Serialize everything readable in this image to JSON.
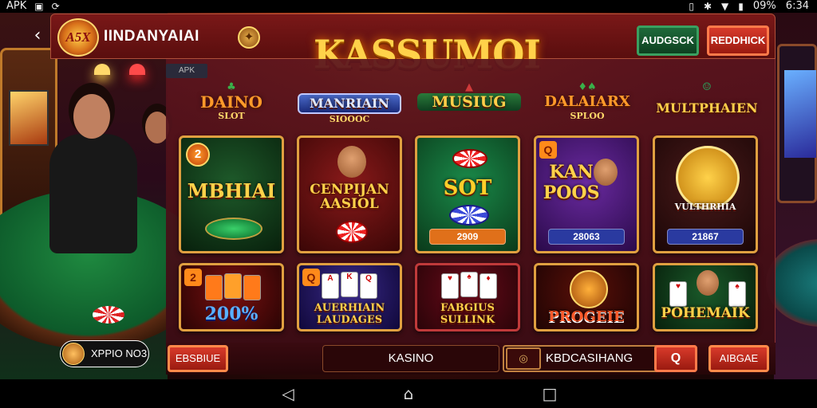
{
  "statusbar": {
    "left_label": "APK",
    "right_battery": "09%",
    "time": "6:34"
  },
  "header": {
    "app_title": "IINDANYAIAI",
    "logo_text": "A5X",
    "hero_title": "KASSUMOI",
    "btn_green": "AUDGSCK",
    "btn_red": "REDDHICK"
  },
  "categories": [
    {
      "main": "DAINO",
      "sub": "SLOT",
      "color": "#ff9a2a"
    },
    {
      "main": "MANRIAIN",
      "sub": "SIOOOC",
      "color": "#4a8ad8"
    },
    {
      "main": "MUSIUG",
      "sub": "",
      "color": "#ffcf4a"
    },
    {
      "main": "DALAIARX",
      "sub": "SPLOO",
      "color": "#ff9a2a"
    },
    {
      "main": "MULTPHAIEN",
      "sub": "",
      "color": "#ffcf4a"
    }
  ],
  "tiles_row1": [
    {
      "label": "MBHIAI",
      "badge": "2",
      "price": ""
    },
    {
      "label": "CENPIJAN AASIOL",
      "badge": "",
      "price": ""
    },
    {
      "label": "SOT",
      "badge": "",
      "price": "2909"
    },
    {
      "label": "KAN POOS",
      "badge": "Q",
      "price": "28063"
    },
    {
      "label": "VULTHRHIA",
      "badge": "",
      "price": "21867"
    }
  ],
  "tiles_row2": [
    {
      "label": "200%",
      "badge": "2"
    },
    {
      "label": "AUERHIAIN LAUDAGES",
      "badge": "Q"
    },
    {
      "label": "FABGIUS SULLINK",
      "badge": ""
    },
    {
      "label": "PROGEIE",
      "badge": ""
    },
    {
      "label": "POHEMAIK",
      "badge": ""
    }
  ],
  "bottom": {
    "left_btn": "EBSBIUE",
    "casino_tab": "KASINO",
    "search_value": "KBDCASIHANG",
    "search_go": "Q",
    "right_btn": "AIBGAE"
  },
  "user": {
    "name": "XPPIO NO3"
  },
  "colors": {
    "accent_red": "#d83a2a",
    "accent_gold": "#ffd24a",
    "accent_green": "#1e6a3a"
  }
}
